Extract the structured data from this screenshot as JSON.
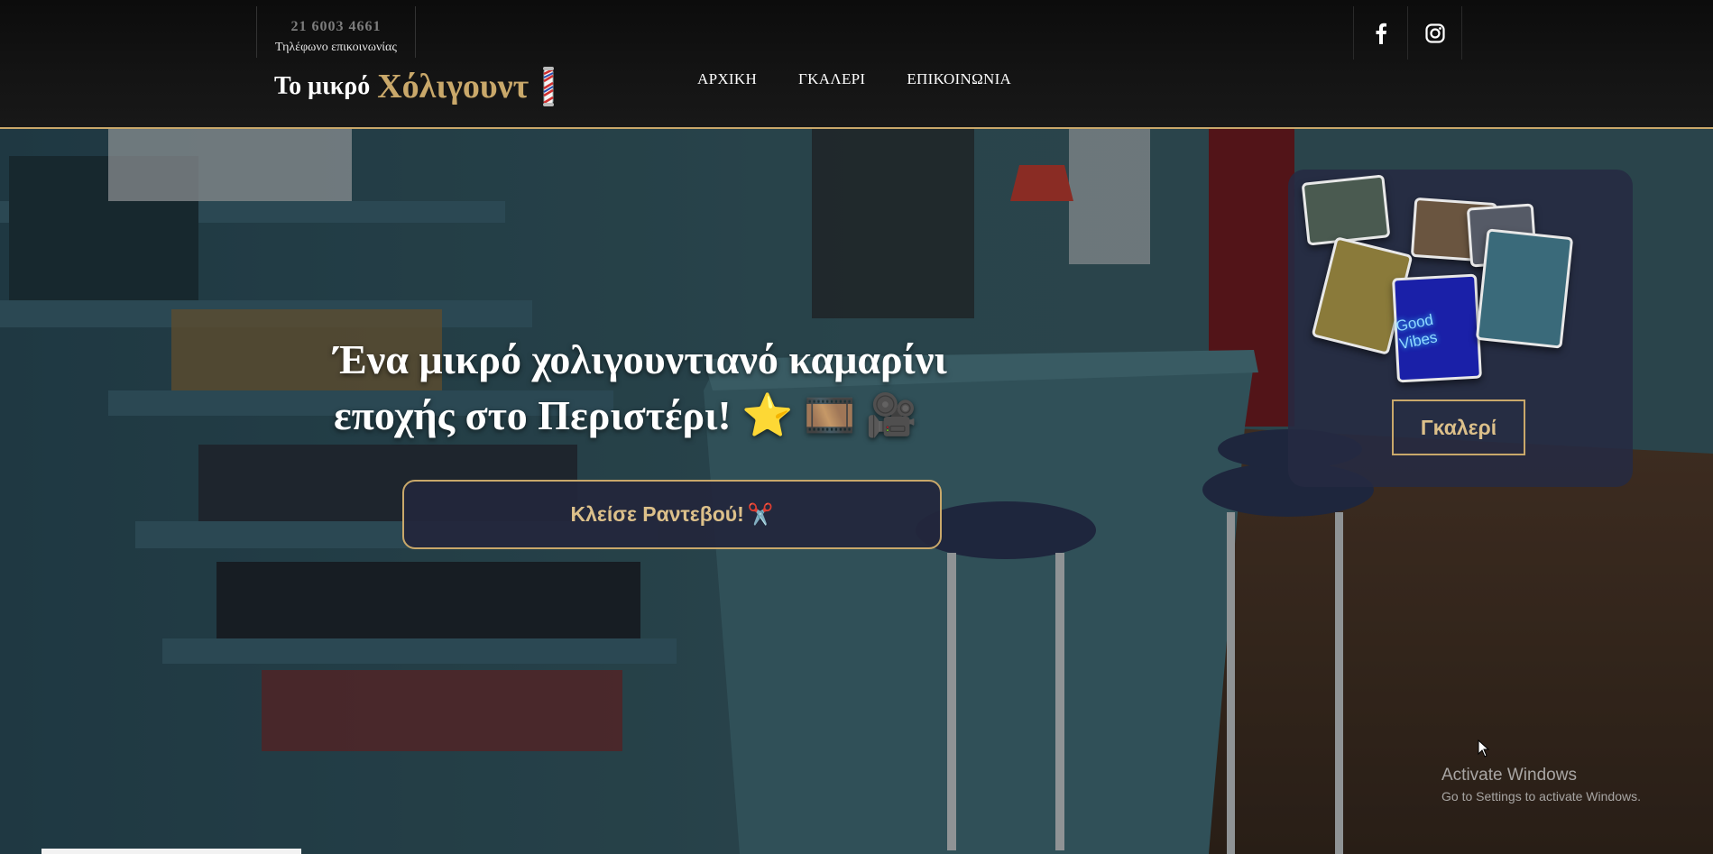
{
  "header": {
    "phone_number": "21 6003 4661",
    "phone_caption": "Τηλέφωνο επικοινωνίας",
    "logo_small": "Το μικρό",
    "logo_big": "Χόλιγουντ",
    "nav": [
      {
        "label": "ΑΡΧΙΚΗ"
      },
      {
        "label": "ΓΚΑΛΕΡΙ"
      },
      {
        "label": "ΕΠΙΚΟΙΝΩΝΙΑ"
      }
    ],
    "social": [
      {
        "icon": "facebook-icon"
      },
      {
        "icon": "instagram-icon"
      }
    ]
  },
  "hero": {
    "title_line1": "Ένα μικρό χολιγουντιανό καμαρίνι",
    "title_line2": "εποχής στο Περιστέρι!",
    "title_emojis": "⭐ 🎞️ 🎥",
    "book_button": "Κλείσε Ραντεβού!",
    "book_button_emoji": "✂️",
    "gallery_button": "Γκαλερί",
    "gallery_neon_text": "Good Vibes"
  },
  "os_watermark": {
    "title": "Activate Windows",
    "subtitle": "Go to Settings to activate Windows."
  },
  "colors": {
    "accent_gold": "#c9a86a",
    "header_bg": "#141414",
    "button_bg": "#23263c"
  }
}
